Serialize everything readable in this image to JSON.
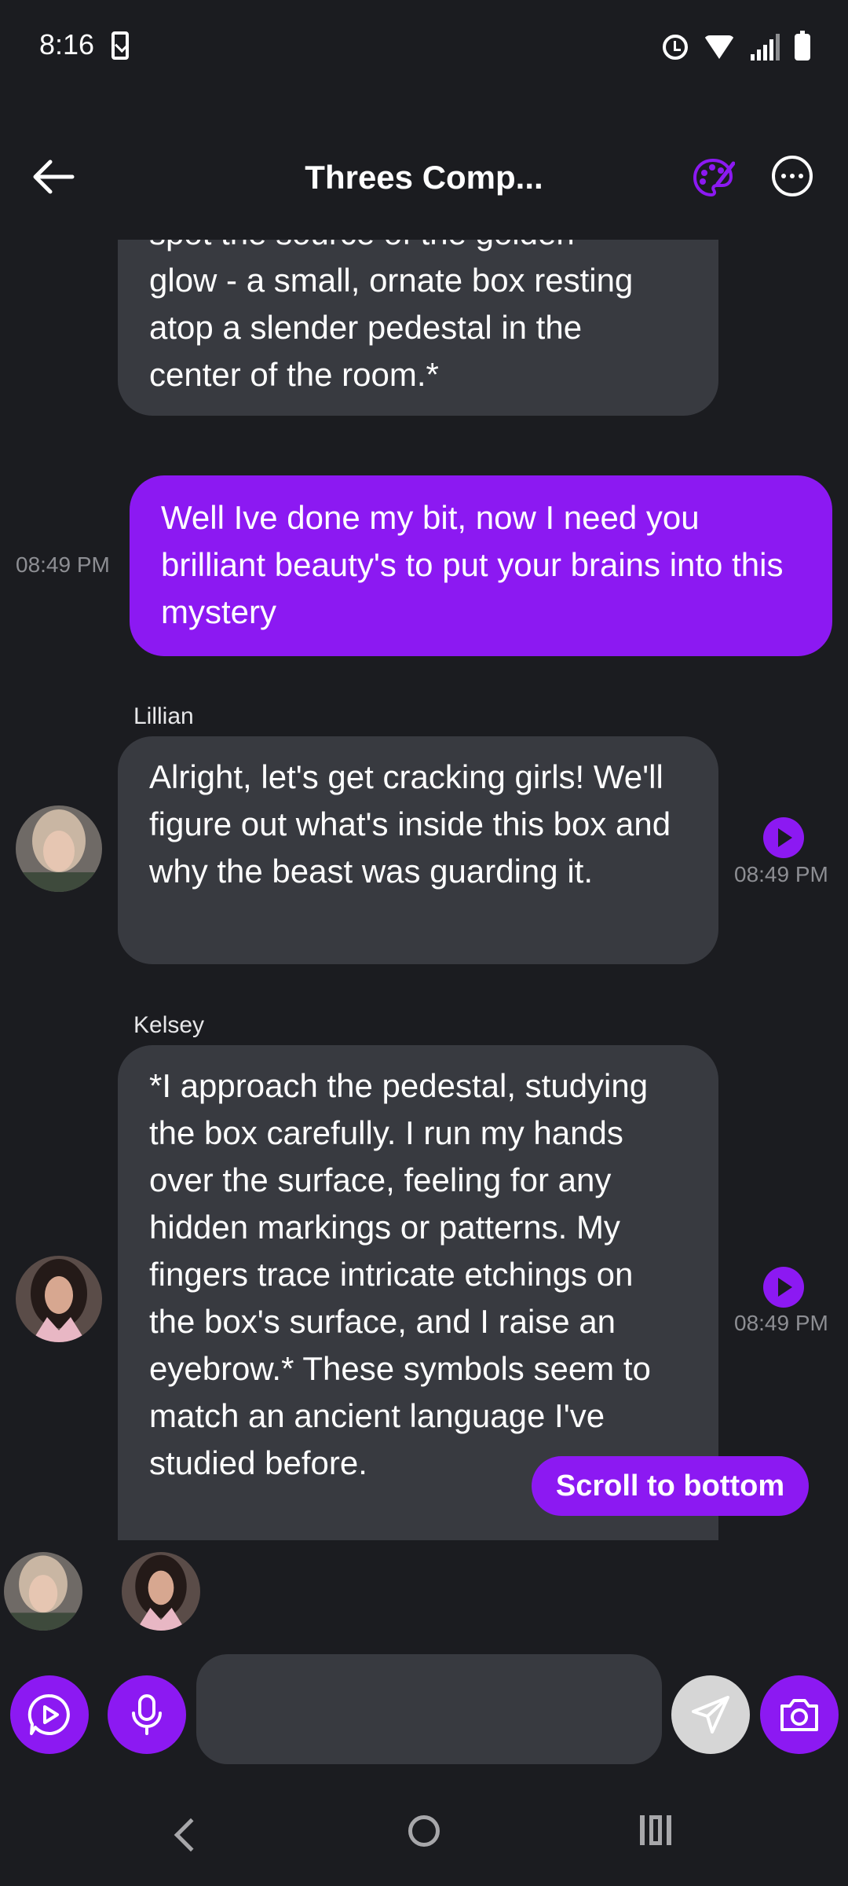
{
  "status_bar": {
    "time": "8:16"
  },
  "header": {
    "title": "Threes Comp..."
  },
  "messages": [
    {
      "sender": "",
      "text_lines": [
        "spot the source of the golden",
        "glow - a small, ornate box resting",
        "atop a slender pedestal in the",
        "center of the room.*"
      ]
    },
    {
      "sender": "me",
      "timestamp": "08:49 PM",
      "text": "Well Ive done my bit, now I need you brilliant beauty's to put your brains into this mystery"
    },
    {
      "sender": "Lillian",
      "timestamp": "08:49 PM",
      "text": "Alright, let's get cracking girls! We'll figure out what's inside this box and why the beast was guarding it."
    },
    {
      "sender": "Kelsey",
      "timestamp": "08:49 PM",
      "text": "*I approach the pedestal, studying the box carefully. I run my hands over the surface, feeling for any hidden markings or patterns. My fingers trace intricate etchings on the box's surface, and I raise an eyebrow.* These symbols seem to match an ancient language I've studied before."
    }
  ],
  "scroll_button": {
    "label": "Scroll to bottom"
  },
  "input": {
    "placeholder": ""
  },
  "colors": {
    "accent": "#8c19f2",
    "bubble": "#383a40",
    "background": "#1b1c20"
  }
}
